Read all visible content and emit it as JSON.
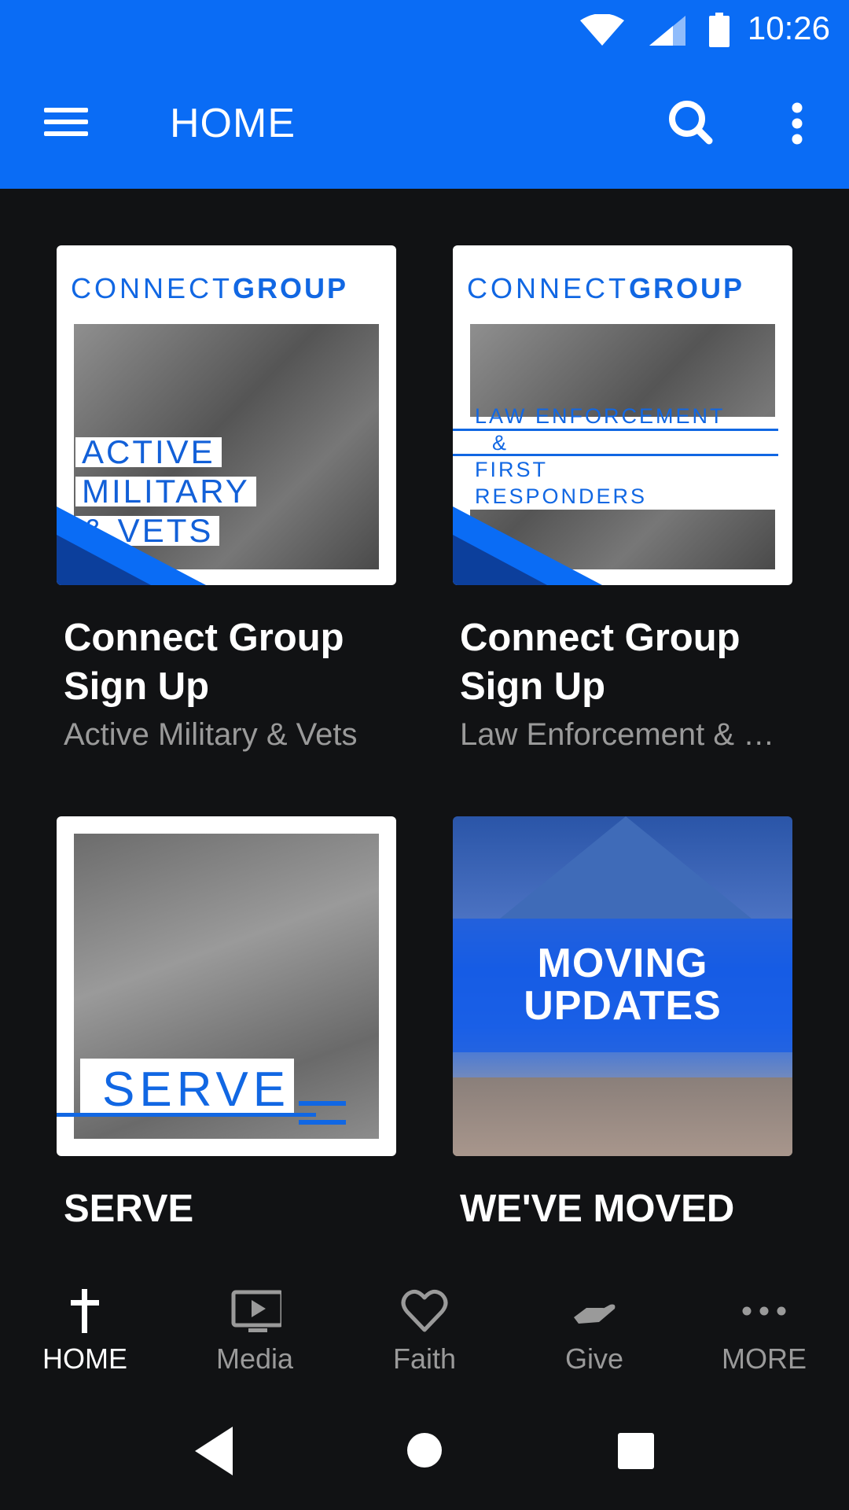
{
  "status_bar": {
    "time": "10:26"
  },
  "toolbar": {
    "title": "HOME"
  },
  "cards": [
    {
      "image": {
        "brand_light": "CONNECT",
        "brand_bold": "GROUP",
        "lines": [
          "ACTIVE",
          "MILITARY",
          "& VETS"
        ]
      },
      "title_line1": "Connect Group",
      "title_line2": "Sign Up",
      "subtitle": "Active Military & Vets"
    },
    {
      "image": {
        "brand_light": "CONNECT",
        "brand_bold": "GROUP",
        "lines": [
          "LAW ENFORCEMENT",
          "&",
          "FIRST",
          "RESPONDERS"
        ]
      },
      "title_line1": "Connect Group",
      "title_line2": "Sign Up",
      "subtitle": "Law Enforcement & First Responders"
    },
    {
      "image": {
        "label": "SERVE"
      },
      "title_line1": "SERVE"
    },
    {
      "image": {
        "line1": "MOVING",
        "line2": "UPDATES"
      },
      "title_line1": "WE'VE MOVED"
    }
  ],
  "bottom_nav": [
    {
      "label": "HOME",
      "icon": "cross-icon",
      "active": true
    },
    {
      "label": "Media",
      "icon": "tv-play-icon",
      "active": false
    },
    {
      "label": "Faith",
      "icon": "heart-icon",
      "active": false
    },
    {
      "label": "Give",
      "icon": "giving-hand-icon",
      "active": false
    },
    {
      "label": "MORE",
      "icon": "more-horizontal-icon",
      "active": false
    }
  ],
  "colors": {
    "app_bar": "#0a6cf5",
    "background": "#111214",
    "accent": "#1167e3",
    "inactive": "#9a9a9a"
  }
}
